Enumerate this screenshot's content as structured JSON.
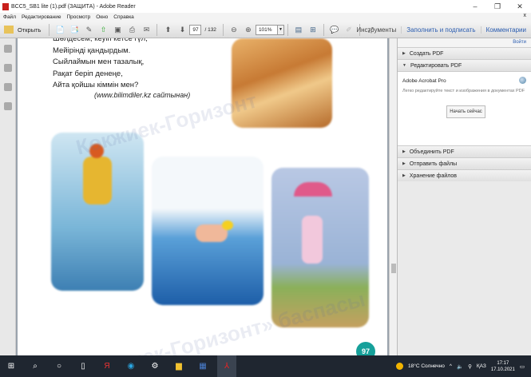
{
  "window": {
    "title": "BCC5_SB1 lite (1).pdf (ЗАЩИТА) - Adobe Reader",
    "minimize": "–",
    "maximize": "❐",
    "close": "✕"
  },
  "menu": {
    "items": [
      "Файл",
      "Редактирование",
      "Просмотр",
      "Окно",
      "Справка"
    ],
    "close": "x"
  },
  "toolbar": {
    "open_label": "Открыть",
    "page_current": "97",
    "page_total": "/ 132",
    "zoom": "101%",
    "tools": "Инструменты",
    "fill_sign": "Заполнить и подписать",
    "comments": "Комментарии"
  },
  "document": {
    "poem": [
      "Шөлдесем, кеуіп кетсе гүл,",
      "Мейірінді қандырдым.",
      "Сыйлаймын мен тазалық,",
      "Рақат беріп денеңе,",
      "Айта қойшы кіммін мен?"
    ],
    "source": "(www.bilimdiler.kz сайтынан)",
    "watermark": [
      "Көкжиек-Горизонт",
      "«Көкжиек-Горизонт» баспасы"
    ],
    "page_number": "97"
  },
  "panel": {
    "login": "Войти",
    "create_pdf": "Создать PDF",
    "edit_pdf": "Редактировать PDF",
    "product": "Adobe Acrobat Pro",
    "description": "Легко редактируйте текст и изображения в документах PDF",
    "start_button": "Начать сейчас",
    "combine_pdf": "Объединить PDF",
    "send_files": "Отправить файлы",
    "store_files": "Хранение файлов"
  },
  "taskbar": {
    "weather": "18°C Солнечно",
    "lang": "ҚАЗ",
    "time": "17:17",
    "date": "17.10.2021"
  }
}
